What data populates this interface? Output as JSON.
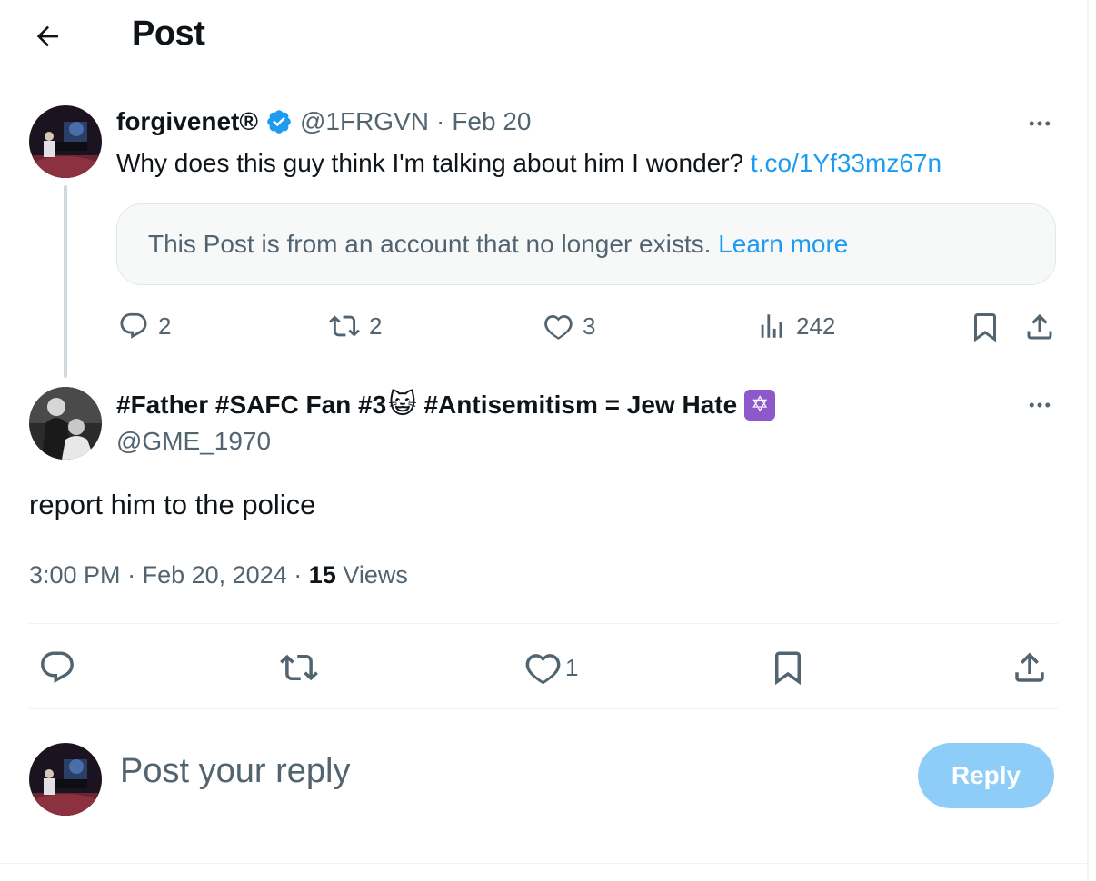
{
  "header": {
    "title": "Post"
  },
  "parent_post": {
    "display_name": "forgivenet®",
    "handle": "@1FRGVN",
    "separator": "·",
    "date": "Feb 20",
    "text": "Why does this guy think I'm talking about him I wonder?",
    "link": "t.co/1Yf33mz67n",
    "notice_text": "This Post is from an account that no longer exists.",
    "notice_link": "Learn more",
    "replies": "2",
    "reposts": "2",
    "likes": "3",
    "views": "242"
  },
  "main_post": {
    "display_name_part1": "#Father #SAFC Fan #3",
    "emoji": "😺",
    "display_name_part2": "#Antisemitism = Jew Hate",
    "star_emoji": "✡",
    "handle": "@GME_1970",
    "text": "report him to the police",
    "time": "3:00 PM",
    "separator": "·",
    "date": "Feb 20, 2024",
    "views_count": "15",
    "views_label": "Views",
    "likes": "1"
  },
  "composer": {
    "placeholder": "Post your reply",
    "button_label": "Reply"
  },
  "colors": {
    "accent": "#1d9bf0",
    "verified": "#1d9bf0",
    "reply_button_disabled": "#8ecdf8",
    "muted_text": "#536471"
  },
  "icons": {
    "back": "arrow-left-icon",
    "verified": "verified-badge-icon",
    "more": "more-horizontal-icon",
    "reply": "reply-bubble-icon",
    "repost": "repost-icon",
    "like": "heart-icon",
    "views": "analytics-icon",
    "bookmark": "bookmark-icon",
    "share": "share-icon"
  }
}
